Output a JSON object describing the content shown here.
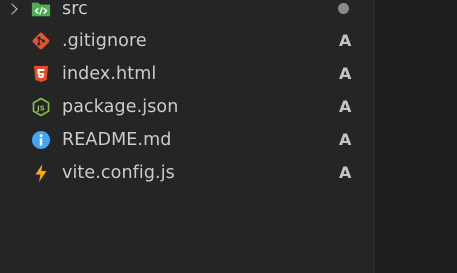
{
  "explorer": {
    "items": [
      {
        "label": "src",
        "icon": "folder-src-icon",
        "status": ""
      },
      {
        "label": ".gitignore",
        "icon": "git-icon",
        "status": "A"
      },
      {
        "label": "index.html",
        "icon": "html5-icon",
        "status": "A"
      },
      {
        "label": "package.json",
        "icon": "nodejs-icon",
        "status": "A"
      },
      {
        "label": "README.md",
        "icon": "info-icon",
        "status": "A"
      },
      {
        "label": "vite.config.js",
        "icon": "vite-bolt-icon",
        "status": "A"
      }
    ]
  },
  "colors": {
    "sidebar_bg": "#252526",
    "editor_bg": "#1e1e1e",
    "text": "#cccccc",
    "git_orange": "#e7532d",
    "html_orange": "#e44d26",
    "node_green": "#8bc34a",
    "info_blue": "#42a5f5",
    "vite_yellow": "#ffab00",
    "folder_green": "#4caf50"
  }
}
